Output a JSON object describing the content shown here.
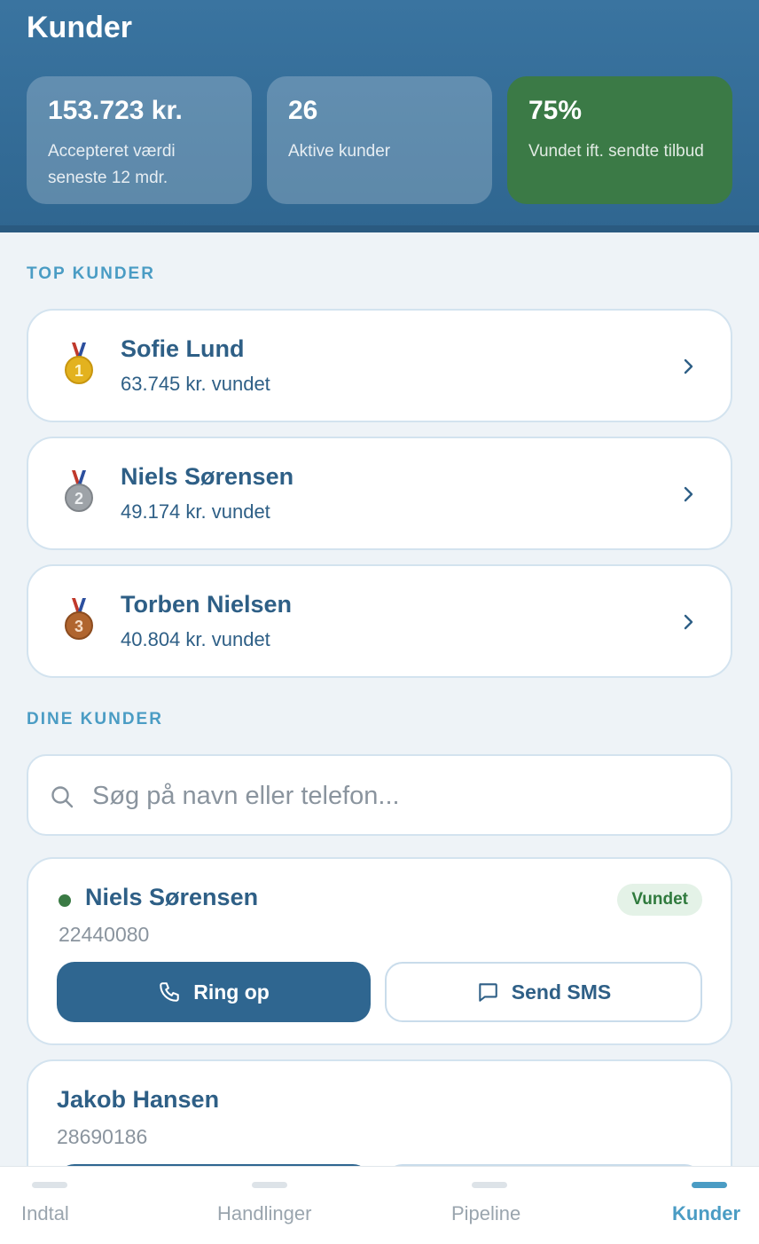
{
  "header": {
    "title": "Kunder",
    "stats": [
      {
        "value": "153.723 kr.",
        "label": "Accepteret værdi seneste 12 mdr."
      },
      {
        "value": "26",
        "label": "Aktive kunder"
      },
      {
        "value": "75%",
        "label": "Vundet ift. sendte tilbud"
      }
    ]
  },
  "top_customers": {
    "title": "TOP KUNDER",
    "items": [
      {
        "rank": "1",
        "name": "Sofie Lund",
        "amount": "63.745 kr. vundet"
      },
      {
        "rank": "2",
        "name": "Niels Sørensen",
        "amount": "49.174 kr. vundet"
      },
      {
        "rank": "3",
        "name": "Torben Nielsen",
        "amount": "40.804 kr. vundet"
      }
    ]
  },
  "your_customers": {
    "title": "DINE KUNDER",
    "search_placeholder": "Søg på navn eller telefon...",
    "items": [
      {
        "name": "Niels Sørensen",
        "phone": "22440080",
        "status": "Vundet",
        "call_label": "Ring op",
        "sms_label": "Send SMS"
      },
      {
        "name": "Jakob Hansen",
        "phone": "28690186"
      }
    ]
  },
  "tabs": [
    {
      "label": "Indtal"
    },
    {
      "label": "Handlinger"
    },
    {
      "label": "Pipeline"
    },
    {
      "label": "Kunder",
      "active": true
    }
  ],
  "colors": {
    "header": "#2f6690",
    "accent": "#4a9cc4",
    "won_green": "#3b7a46",
    "gold": "#e3b21f",
    "silver": "#9ea3a8",
    "bronze": "#b0652f"
  },
  "icons": [
    "medal-gold-icon",
    "medal-silver-icon",
    "medal-bronze-icon",
    "chevron-right-icon",
    "search-icon",
    "phone-icon",
    "message-icon"
  ]
}
